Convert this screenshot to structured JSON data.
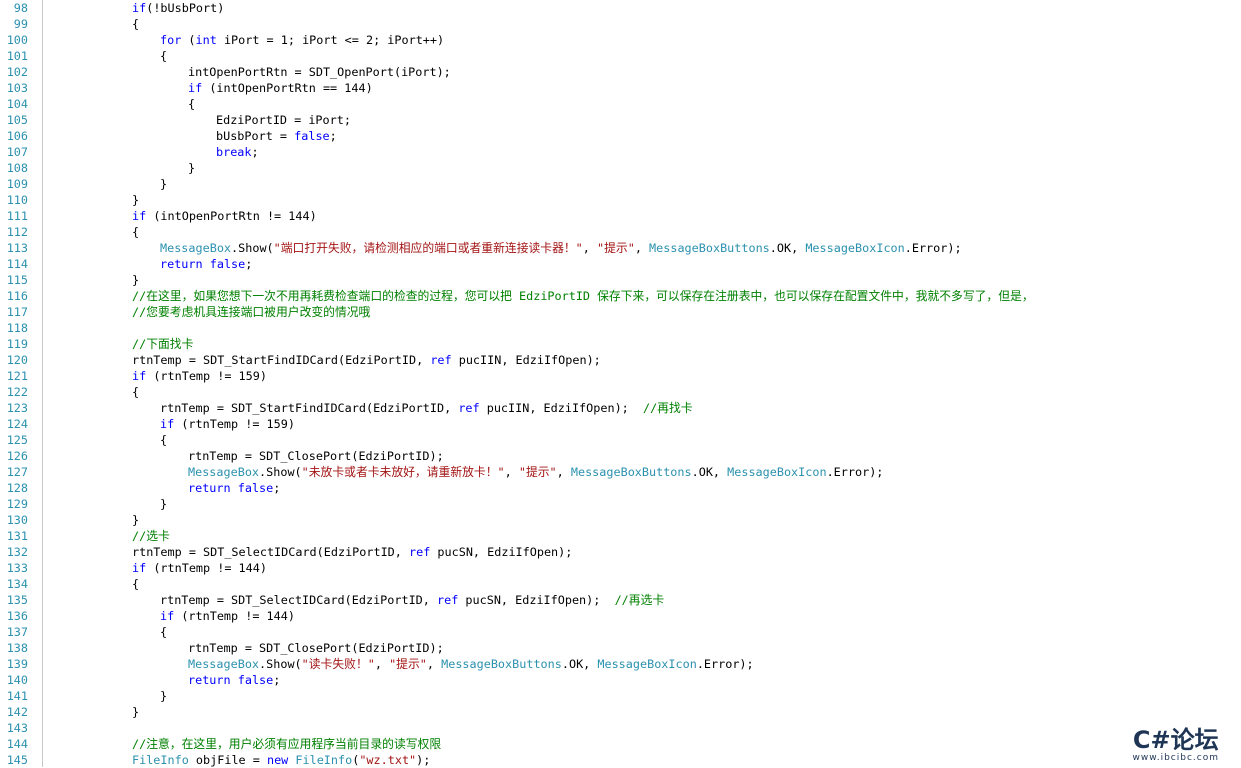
{
  "colors": {
    "line_number": "#2b91af",
    "keyword": "#0000ff",
    "type": "#2b91af",
    "string": "#a31515",
    "comment": "#008000",
    "plain": "#000000",
    "background": "#ffffff"
  },
  "watermark": {
    "logo": "C#论坛",
    "url": "www.ibcibc.com"
  },
  "lines": [
    {
      "n": "98",
      "indent": 3,
      "tokens": [
        [
          "kw",
          "if"
        ],
        [
          "",
          "(!bUsbPort)"
        ]
      ]
    },
    {
      "n": "99",
      "indent": 3,
      "tokens": [
        [
          "",
          "{"
        ]
      ]
    },
    {
      "n": "100",
      "indent": 4,
      "tokens": [
        [
          "kw",
          "for"
        ],
        [
          "",
          " ("
        ],
        [
          "kw",
          "int"
        ],
        [
          "",
          " iPort = 1; iPort <= 2; iPort++)"
        ]
      ]
    },
    {
      "n": "101",
      "indent": 4,
      "tokens": [
        [
          "",
          "{"
        ]
      ]
    },
    {
      "n": "102",
      "indent": 5,
      "tokens": [
        [
          "",
          "intOpenPortRtn = SDT_OpenPort(iPort);"
        ]
      ]
    },
    {
      "n": "103",
      "indent": 5,
      "tokens": [
        [
          "kw",
          "if"
        ],
        [
          "",
          " (intOpenPortRtn == 144)"
        ]
      ]
    },
    {
      "n": "104",
      "indent": 5,
      "tokens": [
        [
          "",
          "{"
        ]
      ]
    },
    {
      "n": "105",
      "indent": 6,
      "tokens": [
        [
          "",
          "EdziPortID = iPort;"
        ]
      ]
    },
    {
      "n": "106",
      "indent": 6,
      "tokens": [
        [
          "",
          "bUsbPort = "
        ],
        [
          "kw",
          "false"
        ],
        [
          "",
          ";"
        ]
      ]
    },
    {
      "n": "107",
      "indent": 6,
      "tokens": [
        [
          "kw",
          "break"
        ],
        [
          "",
          ";"
        ]
      ]
    },
    {
      "n": "108",
      "indent": 5,
      "tokens": [
        [
          "",
          "}"
        ]
      ]
    },
    {
      "n": "109",
      "indent": 4,
      "tokens": [
        [
          "",
          "}"
        ]
      ]
    },
    {
      "n": "110",
      "indent": 3,
      "tokens": [
        [
          "",
          "}"
        ]
      ]
    },
    {
      "n": "111",
      "indent": 3,
      "tokens": [
        [
          "kw",
          "if"
        ],
        [
          "",
          " (intOpenPortRtn != 144)"
        ]
      ]
    },
    {
      "n": "112",
      "indent": 3,
      "tokens": [
        [
          "",
          "{"
        ]
      ]
    },
    {
      "n": "113",
      "indent": 4,
      "tokens": [
        [
          "type",
          "MessageBox"
        ],
        [
          "",
          ".Show("
        ],
        [
          "str",
          "\"端口打开失败，请检测相应的端口或者重新连接读卡器！\""
        ],
        [
          "",
          ", "
        ],
        [
          "str",
          "\"提示\""
        ],
        [
          "",
          ", "
        ],
        [
          "type",
          "MessageBoxButtons"
        ],
        [
          "",
          ".OK, "
        ],
        [
          "type",
          "MessageBoxIcon"
        ],
        [
          "",
          ".Error);"
        ]
      ]
    },
    {
      "n": "114",
      "indent": 4,
      "tokens": [
        [
          "kw",
          "return"
        ],
        [
          "",
          " "
        ],
        [
          "kw",
          "false"
        ],
        [
          "",
          ";"
        ]
      ]
    },
    {
      "n": "115",
      "indent": 3,
      "tokens": [
        [
          "",
          "}"
        ]
      ]
    },
    {
      "n": "116",
      "indent": 3,
      "tokens": [
        [
          "cmt",
          "//在这里，如果您想下一次不用再耗费检查端口的检查的过程，您可以把 EdziPortID 保存下来，可以保存在注册表中，也可以保存在配置文件中，我就不多写了，但是，"
        ]
      ]
    },
    {
      "n": "117",
      "indent": 3,
      "tokens": [
        [
          "cmt",
          "//您要考虑机具连接端口被用户改变的情况哦"
        ]
      ]
    },
    {
      "n": "118",
      "indent": 0,
      "tokens": []
    },
    {
      "n": "119",
      "indent": 3,
      "tokens": [
        [
          "cmt",
          "//下面找卡"
        ]
      ]
    },
    {
      "n": "120",
      "indent": 3,
      "tokens": [
        [
          "",
          "rtnTemp = SDT_StartFindIDCard(EdziPortID, "
        ],
        [
          "kw",
          "ref"
        ],
        [
          "",
          " pucIIN, EdziIfOpen);"
        ]
      ]
    },
    {
      "n": "121",
      "indent": 3,
      "tokens": [
        [
          "kw",
          "if"
        ],
        [
          "",
          " (rtnTemp != 159)"
        ]
      ]
    },
    {
      "n": "122",
      "indent": 3,
      "tokens": [
        [
          "",
          "{"
        ]
      ]
    },
    {
      "n": "123",
      "indent": 4,
      "tokens": [
        [
          "",
          "rtnTemp = SDT_StartFindIDCard(EdziPortID, "
        ],
        [
          "kw",
          "ref"
        ],
        [
          "",
          " pucIIN, EdziIfOpen);  "
        ],
        [
          "cmt",
          "//再找卡"
        ]
      ]
    },
    {
      "n": "124",
      "indent": 4,
      "tokens": [
        [
          "kw",
          "if"
        ],
        [
          "",
          " (rtnTemp != 159)"
        ]
      ]
    },
    {
      "n": "125",
      "indent": 4,
      "tokens": [
        [
          "",
          "{"
        ]
      ]
    },
    {
      "n": "126",
      "indent": 5,
      "tokens": [
        [
          "",
          "rtnTemp = SDT_ClosePort(EdziPortID);"
        ]
      ]
    },
    {
      "n": "127",
      "indent": 5,
      "tokens": [
        [
          "type",
          "MessageBox"
        ],
        [
          "",
          ".Show("
        ],
        [
          "str",
          "\"未放卡或者卡未放好，请重新放卡！\""
        ],
        [
          "",
          ", "
        ],
        [
          "str",
          "\"提示\""
        ],
        [
          "",
          ", "
        ],
        [
          "type",
          "MessageBoxButtons"
        ],
        [
          "",
          ".OK, "
        ],
        [
          "type",
          "MessageBoxIcon"
        ],
        [
          "",
          ".Error);"
        ]
      ]
    },
    {
      "n": "128",
      "indent": 5,
      "tokens": [
        [
          "kw",
          "return"
        ],
        [
          "",
          " "
        ],
        [
          "kw",
          "false"
        ],
        [
          "",
          ";"
        ]
      ]
    },
    {
      "n": "129",
      "indent": 4,
      "tokens": [
        [
          "",
          "}"
        ]
      ]
    },
    {
      "n": "130",
      "indent": 3,
      "tokens": [
        [
          "",
          "}"
        ]
      ]
    },
    {
      "n": "131",
      "indent": 3,
      "tokens": [
        [
          "cmt",
          "//选卡"
        ]
      ]
    },
    {
      "n": "132",
      "indent": 3,
      "tokens": [
        [
          "",
          "rtnTemp = SDT_SelectIDCard(EdziPortID, "
        ],
        [
          "kw",
          "ref"
        ],
        [
          "",
          " pucSN, EdziIfOpen);"
        ]
      ]
    },
    {
      "n": "133",
      "indent": 3,
      "tokens": [
        [
          "kw",
          "if"
        ],
        [
          "",
          " (rtnTemp != 144)"
        ]
      ]
    },
    {
      "n": "134",
      "indent": 3,
      "tokens": [
        [
          "",
          "{"
        ]
      ]
    },
    {
      "n": "135",
      "indent": 4,
      "tokens": [
        [
          "",
          "rtnTemp = SDT_SelectIDCard(EdziPortID, "
        ],
        [
          "kw",
          "ref"
        ],
        [
          "",
          " pucSN, EdziIfOpen);  "
        ],
        [
          "cmt",
          "//再选卡"
        ]
      ]
    },
    {
      "n": "136",
      "indent": 4,
      "tokens": [
        [
          "kw",
          "if"
        ],
        [
          "",
          " (rtnTemp != 144)"
        ]
      ]
    },
    {
      "n": "137",
      "indent": 4,
      "tokens": [
        [
          "",
          "{"
        ]
      ]
    },
    {
      "n": "138",
      "indent": 5,
      "tokens": [
        [
          "",
          "rtnTemp = SDT_ClosePort(EdziPortID);"
        ]
      ]
    },
    {
      "n": "139",
      "indent": 5,
      "tokens": [
        [
          "type",
          "MessageBox"
        ],
        [
          "",
          ".Show("
        ],
        [
          "str",
          "\"读卡失败！\""
        ],
        [
          "",
          ", "
        ],
        [
          "str",
          "\"提示\""
        ],
        [
          "",
          ", "
        ],
        [
          "type",
          "MessageBoxButtons"
        ],
        [
          "",
          ".OK, "
        ],
        [
          "type",
          "MessageBoxIcon"
        ],
        [
          "",
          ".Error);"
        ]
      ]
    },
    {
      "n": "140",
      "indent": 5,
      "tokens": [
        [
          "kw",
          "return"
        ],
        [
          "",
          " "
        ],
        [
          "kw",
          "false"
        ],
        [
          "",
          ";"
        ]
      ]
    },
    {
      "n": "141",
      "indent": 4,
      "tokens": [
        [
          "",
          "}"
        ]
      ]
    },
    {
      "n": "142",
      "indent": 3,
      "tokens": [
        [
          "",
          "}"
        ]
      ]
    },
    {
      "n": "143",
      "indent": 0,
      "tokens": []
    },
    {
      "n": "144",
      "indent": 3,
      "tokens": [
        [
          "cmt",
          "//注意，在这里，用户必须有应用程序当前目录的读写权限"
        ]
      ]
    },
    {
      "n": "145",
      "indent": 3,
      "tokens": [
        [
          "type",
          "FileInfo"
        ],
        [
          "",
          " objFile = "
        ],
        [
          "kw",
          "new"
        ],
        [
          "",
          " "
        ],
        [
          "type",
          "FileInfo"
        ],
        [
          "",
          "("
        ],
        [
          "str",
          "\"wz.txt\""
        ],
        [
          "",
          ");"
        ]
      ]
    }
  ]
}
